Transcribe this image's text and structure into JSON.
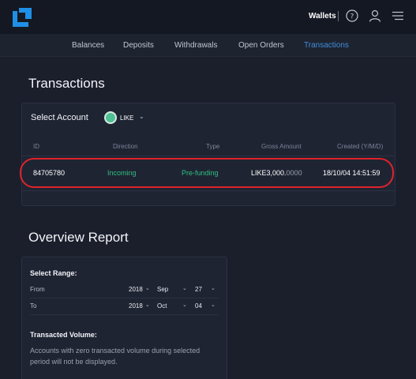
{
  "header": {
    "wallets_label": "Wallets"
  },
  "nav": {
    "tabs": [
      "Balances",
      "Deposits",
      "Withdrawals",
      "Open Orders",
      "Transactions"
    ],
    "active": "Transactions"
  },
  "transactions": {
    "title": "Transactions",
    "select_account_label": "Select Account",
    "account": "LIKE",
    "columns": [
      "ID",
      "Direction",
      "Type",
      "Gross Amount",
      "Created (Y/M/D)"
    ],
    "rows": [
      {
        "id": "84705780",
        "direction": "Incoming",
        "type": "Pre-funding",
        "gross_currency": "LIKE",
        "gross_int": "3,000.",
        "gross_dec": "0000",
        "created": "18/10/04 14:51:59"
      }
    ]
  },
  "overview": {
    "title": "Overview Report",
    "select_range_label": "Select Range:",
    "from": {
      "label": "From",
      "year": "2018",
      "month": "Sep",
      "day": "27"
    },
    "to": {
      "label": "To",
      "year": "2018",
      "month": "Oct",
      "day": "04"
    },
    "transacted_volume_label": "Transacted Volume:",
    "note": "Accounts with zero transacted volume during selected period will not be displayed."
  },
  "colors": {
    "background": "#1b1f2c",
    "accent": "#3f8ed8",
    "positive": "#2fbf80",
    "highlight": "#e0222b"
  }
}
